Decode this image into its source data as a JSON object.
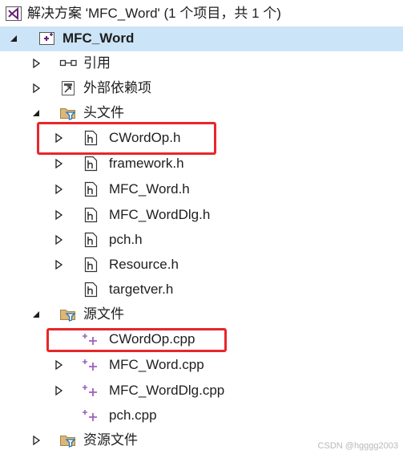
{
  "solution": {
    "label": "解决方案 'MFC_Word' (1 个项目，共 1 个)"
  },
  "project": {
    "label": "MFC_Word"
  },
  "references": {
    "label": "引用"
  },
  "external_deps": {
    "label": "外部依赖项"
  },
  "header_files": {
    "label": "头文件",
    "items": [
      "CWordOp.h",
      "framework.h",
      "MFC_Word.h",
      "MFC_WordDlg.h",
      "pch.h",
      "Resource.h",
      "targetver.h"
    ]
  },
  "source_files": {
    "label": "源文件",
    "items": [
      "CWordOp.cpp",
      "MFC_Word.cpp",
      "MFC_WordDlg.cpp",
      "pch.cpp"
    ]
  },
  "resource_files": {
    "label": "资源文件"
  },
  "watermark": "CSDN @hgggg2003",
  "colors": {
    "selection": "#cce4f7",
    "highlight_box": "#e8262a",
    "vs_purple": "#68217a",
    "cpp_plus": "#a05ec0"
  }
}
